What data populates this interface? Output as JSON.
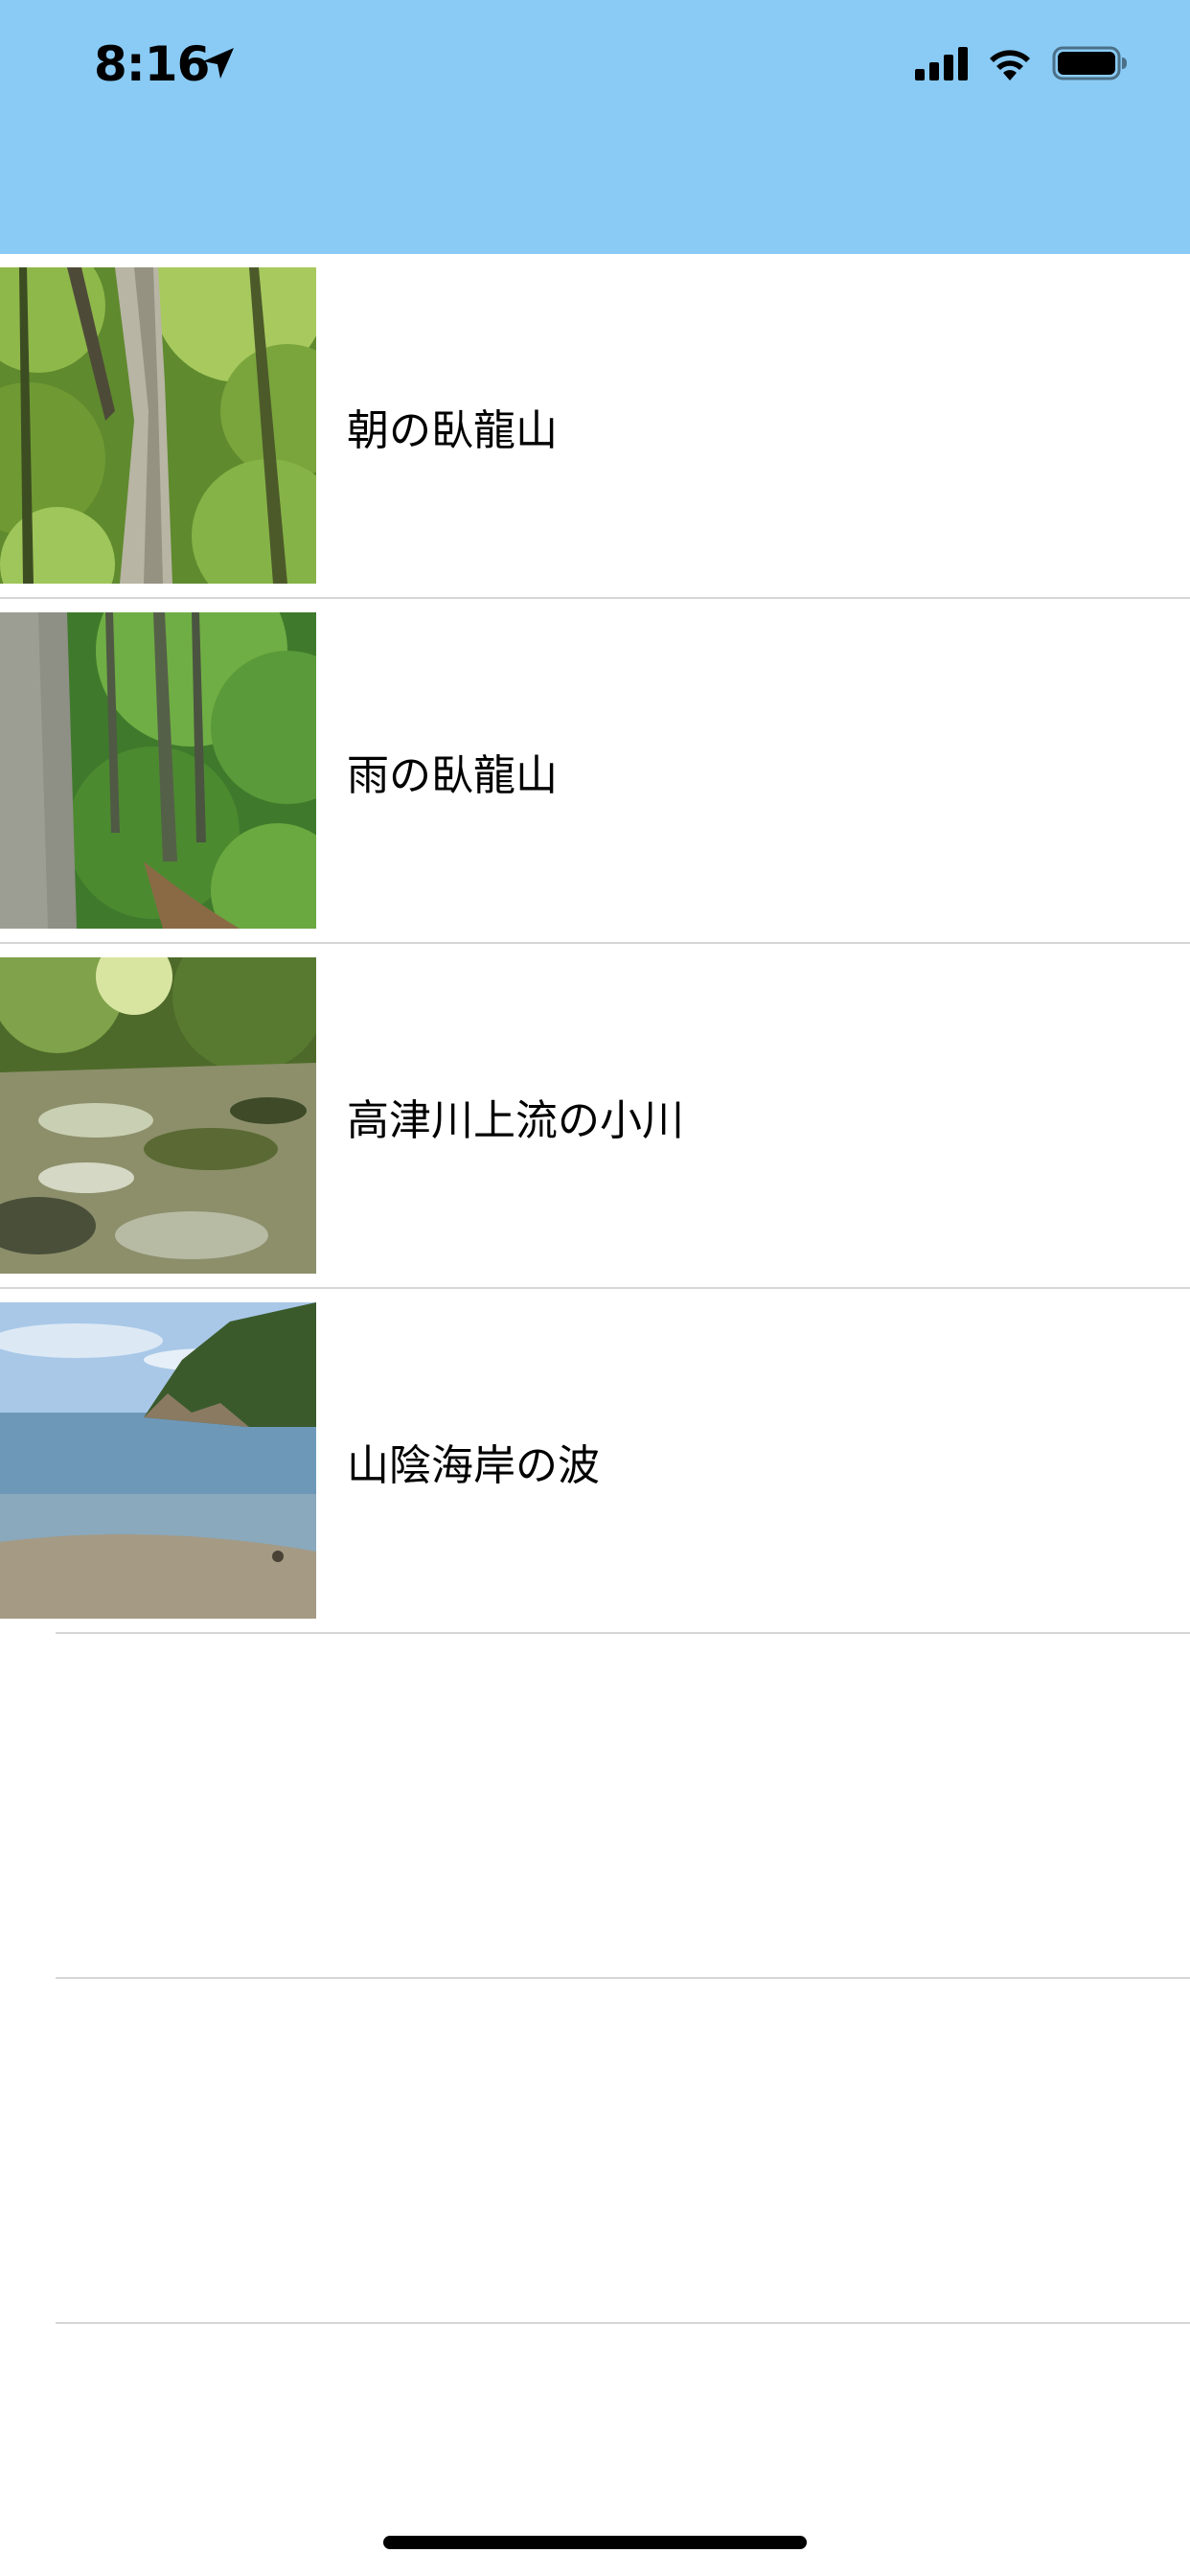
{
  "status_bar": {
    "time": "8:16",
    "icons": [
      "location-arrow-icon",
      "cellular-signal-icon",
      "wifi-icon",
      "battery-icon"
    ]
  },
  "header": {
    "background_color": "#89cbf5"
  },
  "list": {
    "items": [
      {
        "title": "朝の臥龍山",
        "thumbnail": "forest-morning-photo"
      },
      {
        "title": "雨の臥龍山",
        "thumbnail": "forest-rain-photo"
      },
      {
        "title": "高津川上流の小川",
        "thumbnail": "mountain-stream-photo"
      },
      {
        "title": "山陰海岸の波",
        "thumbnail": "coast-waves-photo"
      }
    ]
  }
}
